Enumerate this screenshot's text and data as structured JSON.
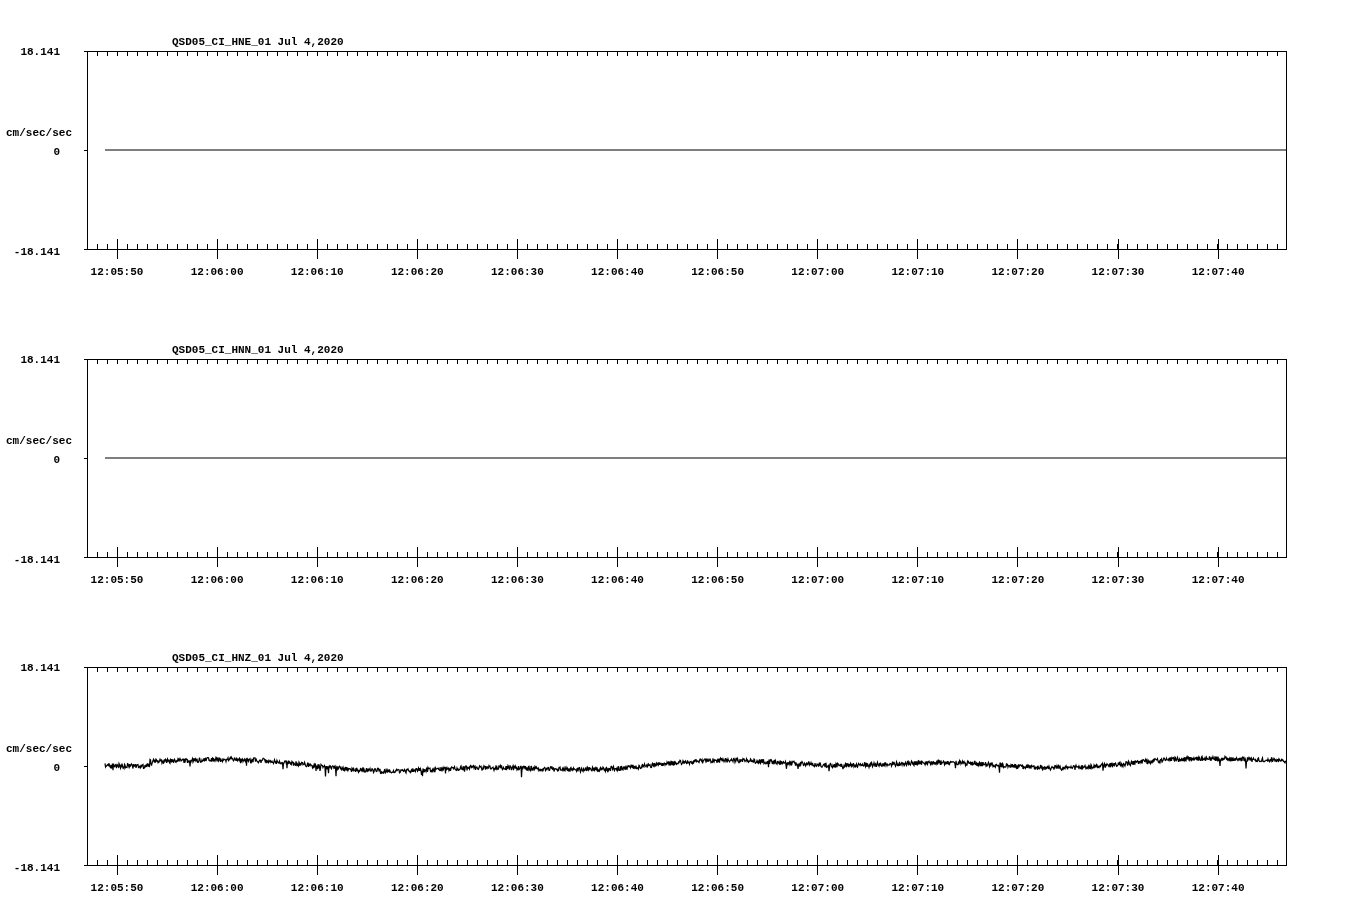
{
  "panels": [
    {
      "title": "QSD05_CI_HNE_01  Jul 4,2020",
      "y_unit": "cm/sec/sec",
      "y_ticks": [
        "18.141",
        "0",
        "-18.141"
      ],
      "x_ticks": [
        "12:05:50",
        "12:06:00",
        "12:06:10",
        "12:06:20",
        "12:06:30",
        "12:06:40",
        "12:06:50",
        "12:07:00",
        "12:07:10",
        "12:07:20",
        "12:07:30",
        "12:07:40"
      ],
      "trace": {
        "kind": "flat"
      }
    },
    {
      "title": "QSD05_CI_HNN_01  Jul 4,2020",
      "y_unit": "cm/sec/sec",
      "y_ticks": [
        "18.141",
        "0",
        "-18.141"
      ],
      "x_ticks": [
        "12:05:50",
        "12:06:00",
        "12:06:10",
        "12:06:20",
        "12:06:30",
        "12:06:40",
        "12:06:50",
        "12:07:00",
        "12:07:10",
        "12:07:20",
        "12:07:30",
        "12:07:40"
      ],
      "trace": {
        "kind": "flat"
      }
    },
    {
      "title": "QSD05_CI_HNZ_01  Jul 4,2020",
      "y_unit": "cm/sec/sec",
      "y_ticks": [
        "18.141",
        "0",
        "-18.141"
      ],
      "x_ticks": [
        "12:05:50",
        "12:06:00",
        "12:06:10",
        "12:06:20",
        "12:06:30",
        "12:06:40",
        "12:06:50",
        "12:07:00",
        "12:07:10",
        "12:07:20",
        "12:07:30",
        "12:07:40"
      ],
      "trace": {
        "kind": "noisy"
      }
    }
  ]
}
